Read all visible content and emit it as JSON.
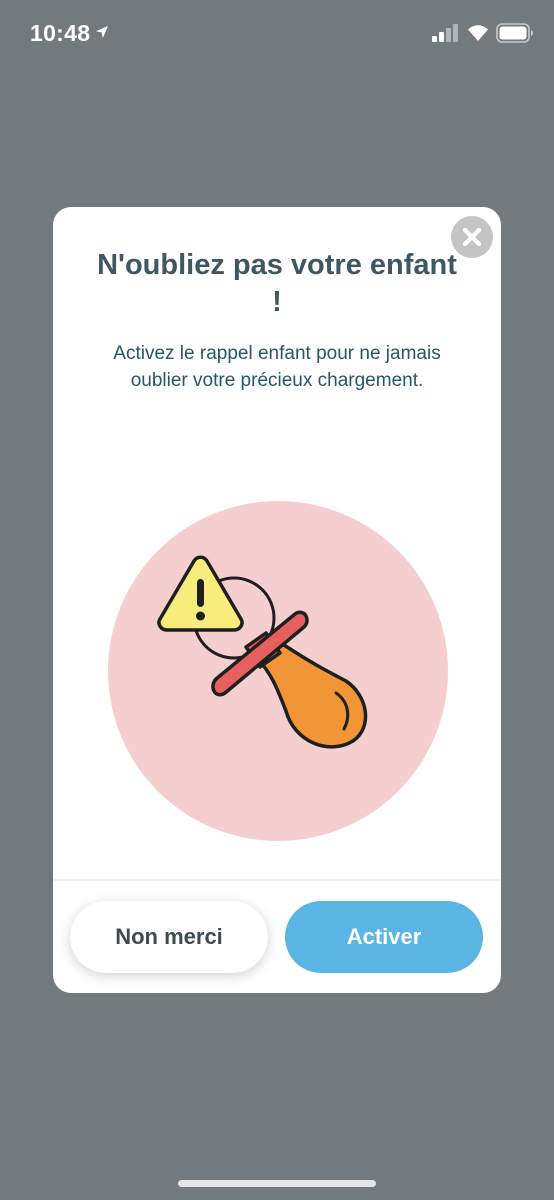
{
  "status_bar": {
    "time": "10:48",
    "location_icon": "location-arrow-icon",
    "signal_icon": "cellular-signal-icon",
    "wifi_icon": "wifi-icon",
    "battery_icon": "battery-icon"
  },
  "modal": {
    "close_icon": "close-icon",
    "title": "N'oubliez pas votre enfant !",
    "message": "Activez le rappel enfant pour ne jamais oublier votre précieux chargement.",
    "illustration": "pacifier-warning-icon",
    "secondary_button_label": "Non merci",
    "primary_button_label": "Activer"
  },
  "colors": {
    "backdrop": "#737a7d",
    "title": "#3f5763",
    "message": "#26566b",
    "primary": "#5ab5e2",
    "circle": "#f5cfd0",
    "warning": "#f8ed7c",
    "pacifier_bulb": "#f19536",
    "pacifier_shield": "#e5605e"
  }
}
